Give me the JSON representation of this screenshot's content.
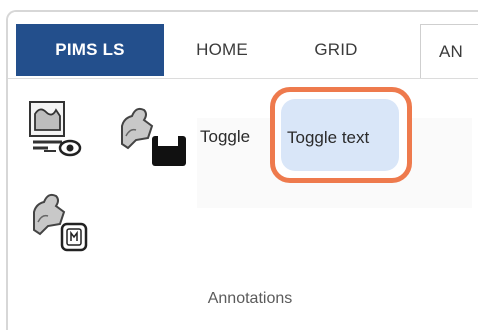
{
  "tabs": {
    "app": "PIMS LS",
    "home": "HOME",
    "grid": "GRID",
    "active": "AN"
  },
  "ribbon": {
    "toggle_label": "Toggle",
    "toggle_text_label": "Toggle text",
    "group_label": "Annotations"
  },
  "icons": {
    "annotation_view": "annotation-view-icon",
    "annotation_save": "annotation-save-icon",
    "annotation_text": "annotation-text-icon"
  },
  "colors": {
    "app_tab": "#234f8c",
    "highlight_border": "#ee7a4d",
    "highlight_fill": "#d9e6f8"
  }
}
